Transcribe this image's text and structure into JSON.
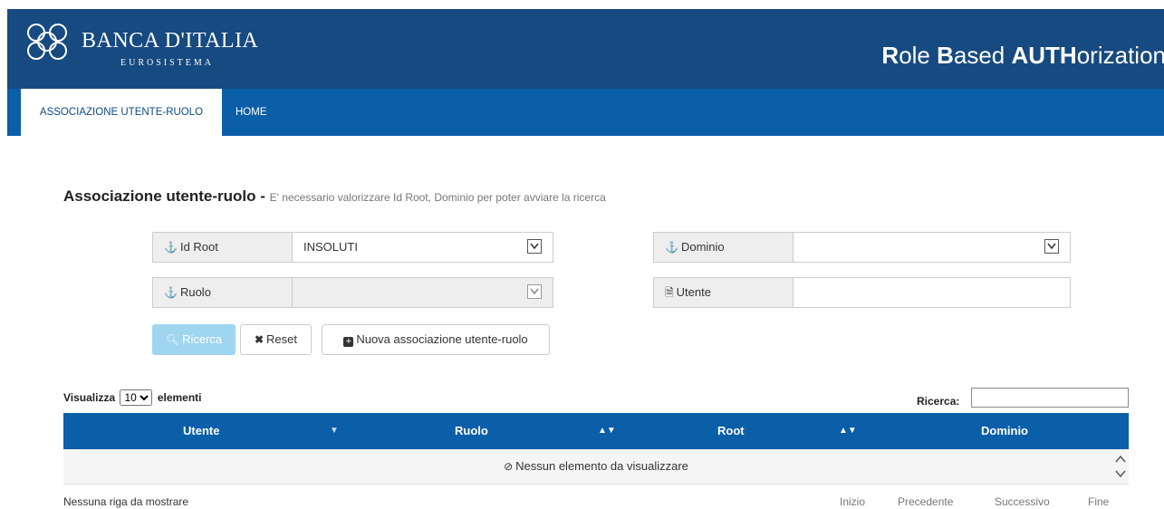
{
  "header": {
    "brand_name": "BANCA D'ITALIA",
    "brand_sub": "EUROSISTEMA",
    "app_title_parts": [
      "R",
      "ole ",
      "B",
      "ased ",
      "AUTH",
      "orization"
    ]
  },
  "nav": {
    "tabs": [
      {
        "label": "ASSOCIAZIONE UTENTE-RUOLO",
        "active": true
      },
      {
        "label": "HOME",
        "active": false
      }
    ]
  },
  "page": {
    "title": "Associazione utente-ruolo - ",
    "subtitle": "E' necessario valorizzare Id Root, Dominio per poter avviare la ricerca"
  },
  "form": {
    "id_root": {
      "label": "Id Root",
      "value": "INSOLUTI"
    },
    "dominio": {
      "label": "Dominio",
      "value": ""
    },
    "ruolo": {
      "label": "Ruolo",
      "value": ""
    },
    "utente": {
      "label": "Utente",
      "value": ""
    }
  },
  "buttons": {
    "ricerca": "Ricerca",
    "reset": "Reset",
    "nuova": "Nuova associazione utente-ruolo"
  },
  "table": {
    "length_prefix": "Visualizza",
    "length_value": "10",
    "length_suffix": "elementi",
    "search_label": "Ricerca:",
    "columns": [
      "Utente",
      "Ruolo",
      "Root",
      "Dominio"
    ],
    "empty_message": "Nessun elemento da visualizzare",
    "info": "Nessuna riga da mostrare",
    "pager": [
      "Inizio",
      "Precedente",
      "Successivo",
      "Fine"
    ]
  },
  "colors": {
    "header_bg": "#164a80",
    "nav_bg": "#0b5ea8",
    "primary_button": "#9fd5ef"
  }
}
